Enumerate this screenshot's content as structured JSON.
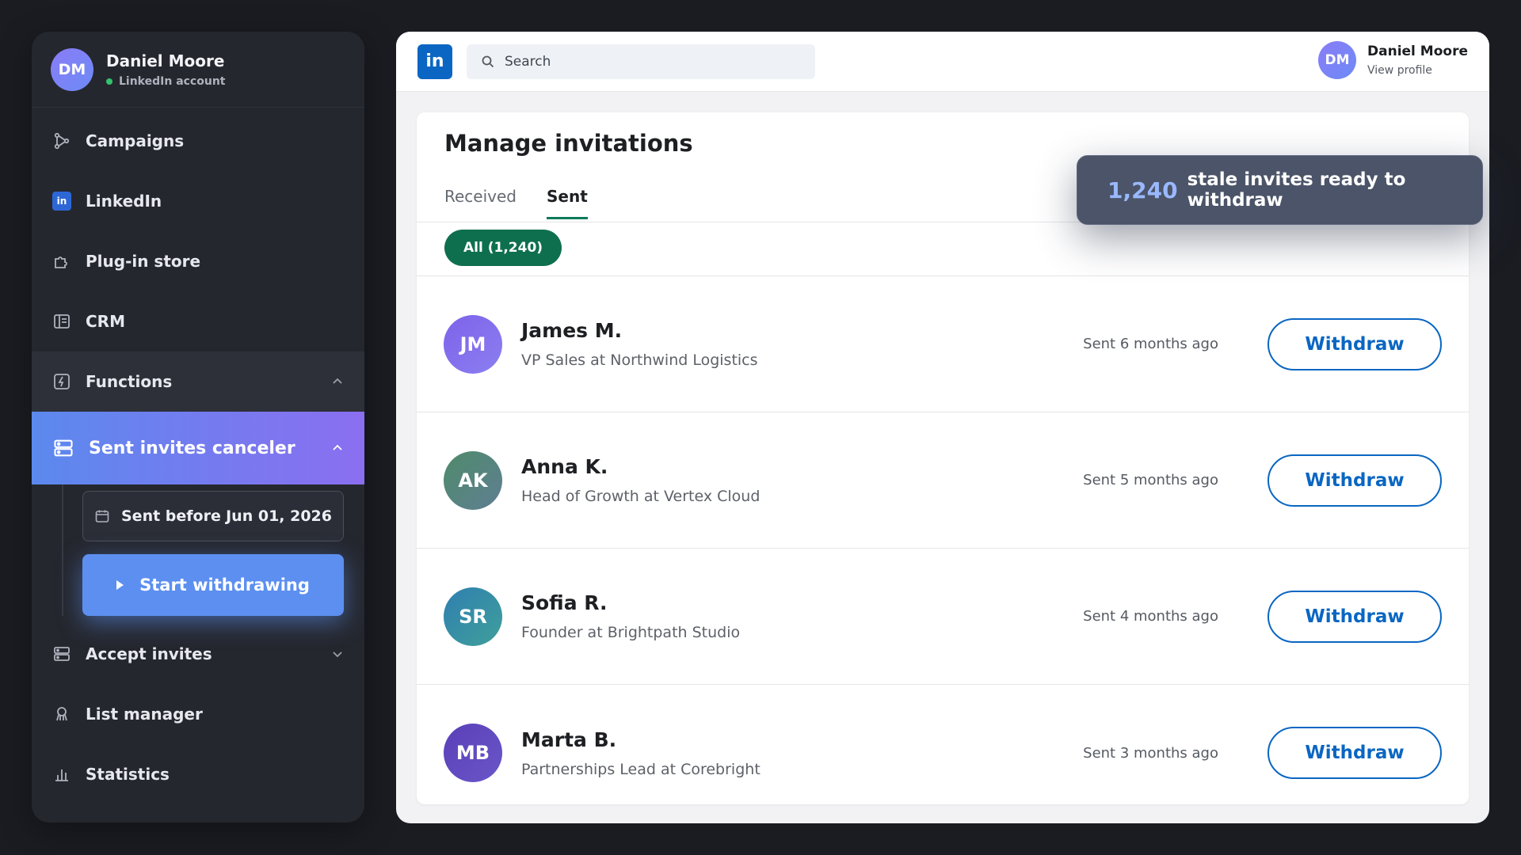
{
  "sidebar": {
    "profile": {
      "initials": "DM",
      "name": "Daniel Moore",
      "status": "LinkedIn account"
    },
    "items": [
      {
        "label": "Campaigns",
        "icon": "campaigns-icon"
      },
      {
        "label": "LinkedIn",
        "icon": "linkedin-icon"
      },
      {
        "label": "Plug-in store",
        "icon": "puzzle-icon"
      },
      {
        "label": "CRM",
        "icon": "crm-icon"
      },
      {
        "label": "Functions",
        "icon": "functions-icon"
      },
      {
        "label": "Sent invites canceler",
        "icon": "server-icon"
      },
      {
        "label": "Accept invites",
        "icon": "server-icon"
      },
      {
        "label": "List manager",
        "icon": "list-manager-icon"
      },
      {
        "label": "Statistics",
        "icon": "bar-chart-icon"
      }
    ],
    "date_filter": {
      "label": "Sent before",
      "value": "Jun 01, 2026"
    },
    "start_button": "Start withdrawing"
  },
  "topbar": {
    "logo": "in",
    "search_placeholder": "Search",
    "profile": {
      "initials": "DM",
      "name": "Daniel Moore",
      "link": "View profile"
    }
  },
  "main": {
    "title": "Manage invitations",
    "tabs": [
      {
        "label": "Received"
      },
      {
        "label": "Sent",
        "active": true
      }
    ],
    "filter_pill": "All (1,240)",
    "invitations": [
      {
        "initials": "JM",
        "name": "James M.",
        "title": "VP Sales at Northwind Logistics",
        "sent": "Sent 6 months ago",
        "action": "Withdraw"
      },
      {
        "initials": "AK",
        "name": "Anna K.",
        "title": "Head of Growth at Vertex Cloud",
        "sent": "Sent 5 months ago",
        "action": "Withdraw"
      },
      {
        "initials": "SR",
        "name": "Sofia R.",
        "title": "Founder at Brightpath Studio",
        "sent": "Sent 4 months ago",
        "action": "Withdraw"
      },
      {
        "initials": "MB",
        "name": "Marta B.",
        "title": "Partnerships Lead at Corebright",
        "sent": "Sent 3 months ago",
        "action": "Withdraw"
      }
    ]
  },
  "toast": {
    "count": "1,240",
    "message": "stale invites ready to withdraw"
  },
  "colors": {
    "accent": "#0a66c2",
    "pill": "#0e6f4e",
    "sidebar_active_start": "#5b89ee",
    "sidebar_active_end": "#8b6ff0",
    "status_dot": "#32c36c"
  }
}
